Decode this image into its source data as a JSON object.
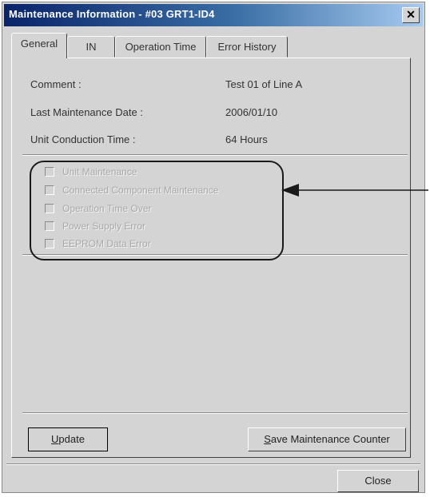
{
  "window": {
    "title": "Maintenance Information - #03 GRT1-ID4"
  },
  "tabs": [
    {
      "label": "General",
      "active": true
    },
    {
      "label": "IN",
      "active": false
    },
    {
      "label": "Operation Time",
      "active": false
    },
    {
      "label": "Error History",
      "active": false
    }
  ],
  "info": {
    "comment_label": "Comment :",
    "comment_value": "Test 01 of Line A",
    "last_maintenance_label": "Last Maintenance Date :",
    "last_maintenance_value": "2006/01/10",
    "conduction_label": "Unit Conduction Time :",
    "conduction_value": "64 Hours"
  },
  "checks": [
    {
      "label": "Unit Maintenance",
      "checked": false
    },
    {
      "label": "Connected Component Maintenance",
      "checked": false
    },
    {
      "label": "Operation Time Over",
      "checked": false
    },
    {
      "label": "Power Supply Error",
      "checked": false
    },
    {
      "label": "EEPROM Data Error",
      "checked": false
    }
  ],
  "buttons": {
    "update_accel": "U",
    "update_rest": "pdate",
    "save_accel": "S",
    "save_rest": "ave Maintenance Counter",
    "close": "Close"
  },
  "colors": {
    "titlebar_start": "#0a246a",
    "titlebar_end": "#a6caf0",
    "face": "#d4d4d4"
  },
  "icons": {
    "close": "close-icon",
    "arrow": "arrow-left-icon"
  }
}
